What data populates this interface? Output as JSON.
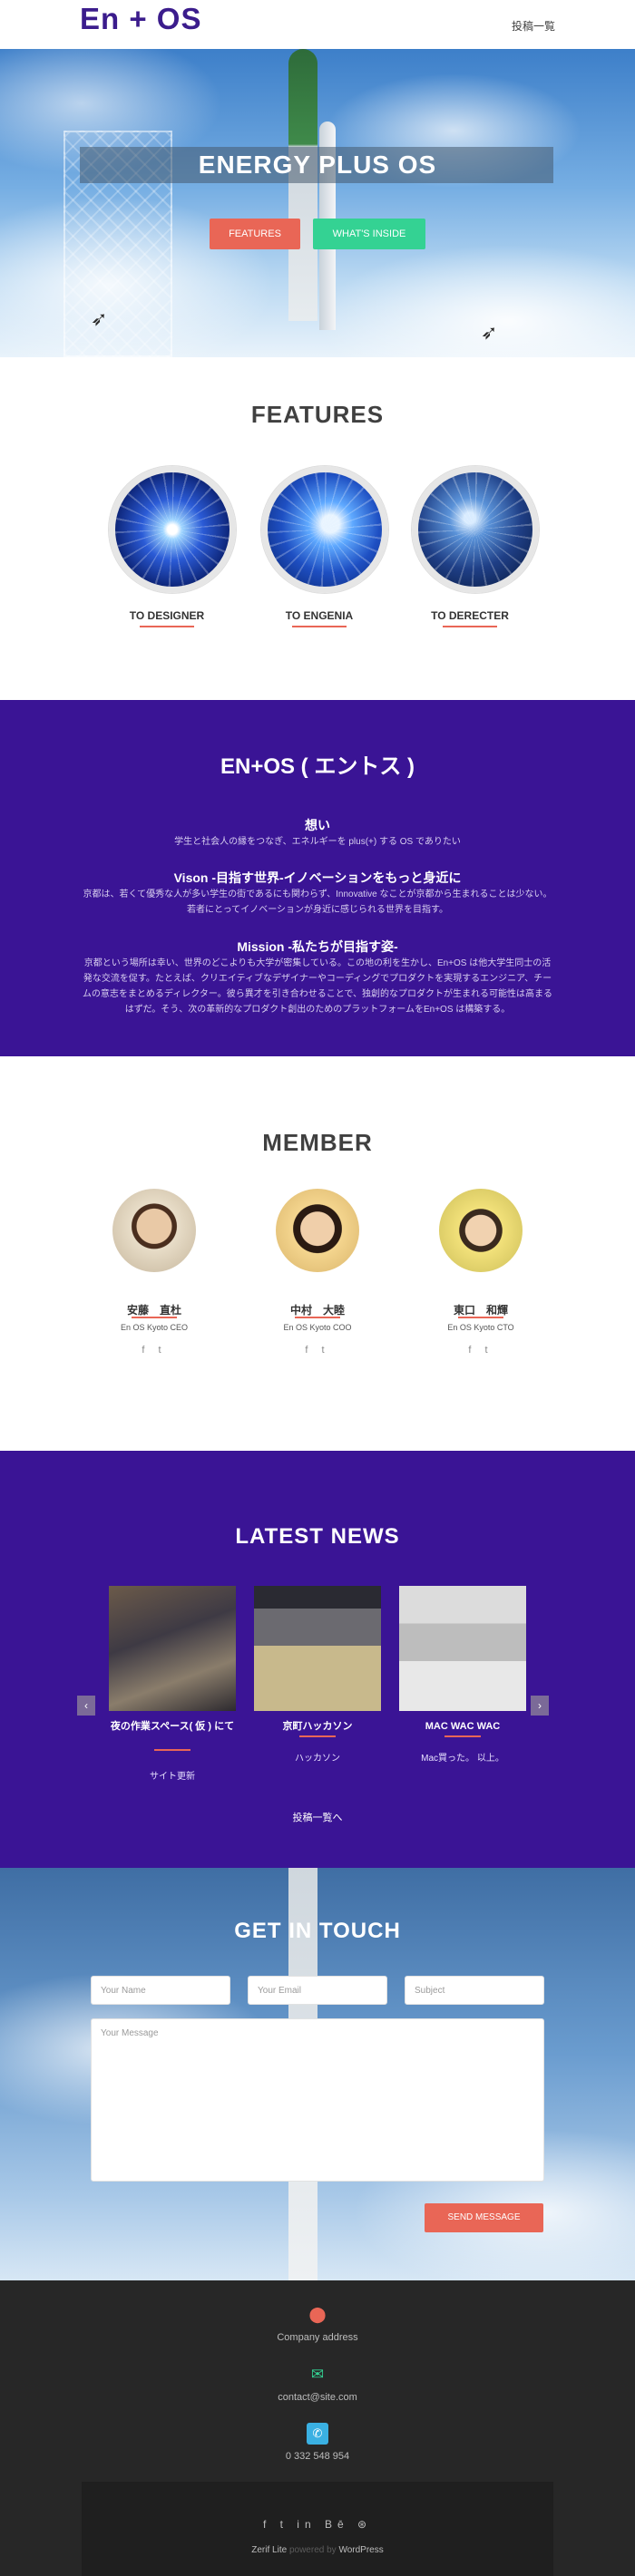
{
  "header": {
    "logo": "En + OS",
    "nav_link": "投稿一覧"
  },
  "hero": {
    "title": "ENERGY PLUS OS",
    "btn_features": "FEATURES",
    "btn_inside": "WHAT'S INSIDE"
  },
  "features": {
    "title": "FEATURES",
    "items": [
      {
        "label": "TO DESIGNER"
      },
      {
        "label": "TO ENGENIA"
      },
      {
        "label": "TO DERECTER"
      }
    ]
  },
  "about": {
    "title": "EN+OS ( エントス )",
    "blocks": [
      {
        "heading": "想い",
        "text": "学生と社会人の縁をつなぎ、エネルギーを plus(+) する OS でありたい"
      },
      {
        "heading": "Vison -目指す世界-イノベーションをもっと身近に",
        "text": "京都は、若くて優秀な人が多い学生の街であるにも関わらず、Innovative なことが京都から生まれることは少ない。若者にとってイノベーションが身近に感じられる世界を目指す。"
      },
      {
        "heading": "Mission -私たちが目指す姿-",
        "text": "京都という場所は幸い、世界のどこよりも大学が密集している。この地の利を生かし、En+OS は他大学生同士の活発な交流を促す。たとえば、クリエイティブなデザイナーやコーディングでプロダクトを実現するエンジニア、チームの意志をまとめるディレクター。彼ら異才を引き合わせることで、独創的なプロダクトが生まれる可能性は高まるはずだ。そう、次の革新的なプロダクト創出のためのプラットフォームをEn+OS は構築する。"
      }
    ]
  },
  "member": {
    "title": "MEMBER",
    "people": [
      {
        "name": "安藤　直杜",
        "role": "En OS Kyoto CEO"
      },
      {
        "name": "中村　大睦",
        "role": "En OS Kyoto COO"
      },
      {
        "name": "東口　和輝",
        "role": "En OS Kyoto CTO"
      }
    ],
    "social": "f  t"
  },
  "news": {
    "title": "LATEST NEWS",
    "items": [
      {
        "caption": "夜の作業スペース( 仮 ) にて",
        "excerpt": "サイト更新"
      },
      {
        "caption": "京町ハッカソン",
        "excerpt": "ハッカソン"
      },
      {
        "caption": "MAC WAC WAC",
        "excerpt": "Mac買った。 以上。"
      }
    ],
    "all_link": "投稿一覧へ",
    "prev": "‹",
    "next": "›"
  },
  "contact": {
    "title": "GET IN TOUCH",
    "name_ph": "Your Name",
    "email_ph": "Your Email",
    "subject_ph": "Subject",
    "message_ph": "Your Message",
    "send": "SEND MESSAGE"
  },
  "footer": {
    "address": "Company address",
    "email": "contact@site.com",
    "phone": "0 332 548 954",
    "social": "f t in Bē ⊛",
    "theme": "Zerif Lite",
    "powered": "powered by",
    "wp": "WordPress"
  },
  "colors": {
    "purple": "#3a1495",
    "coral": "#e96656",
    "green": "#34d293",
    "footer": "#272727"
  }
}
